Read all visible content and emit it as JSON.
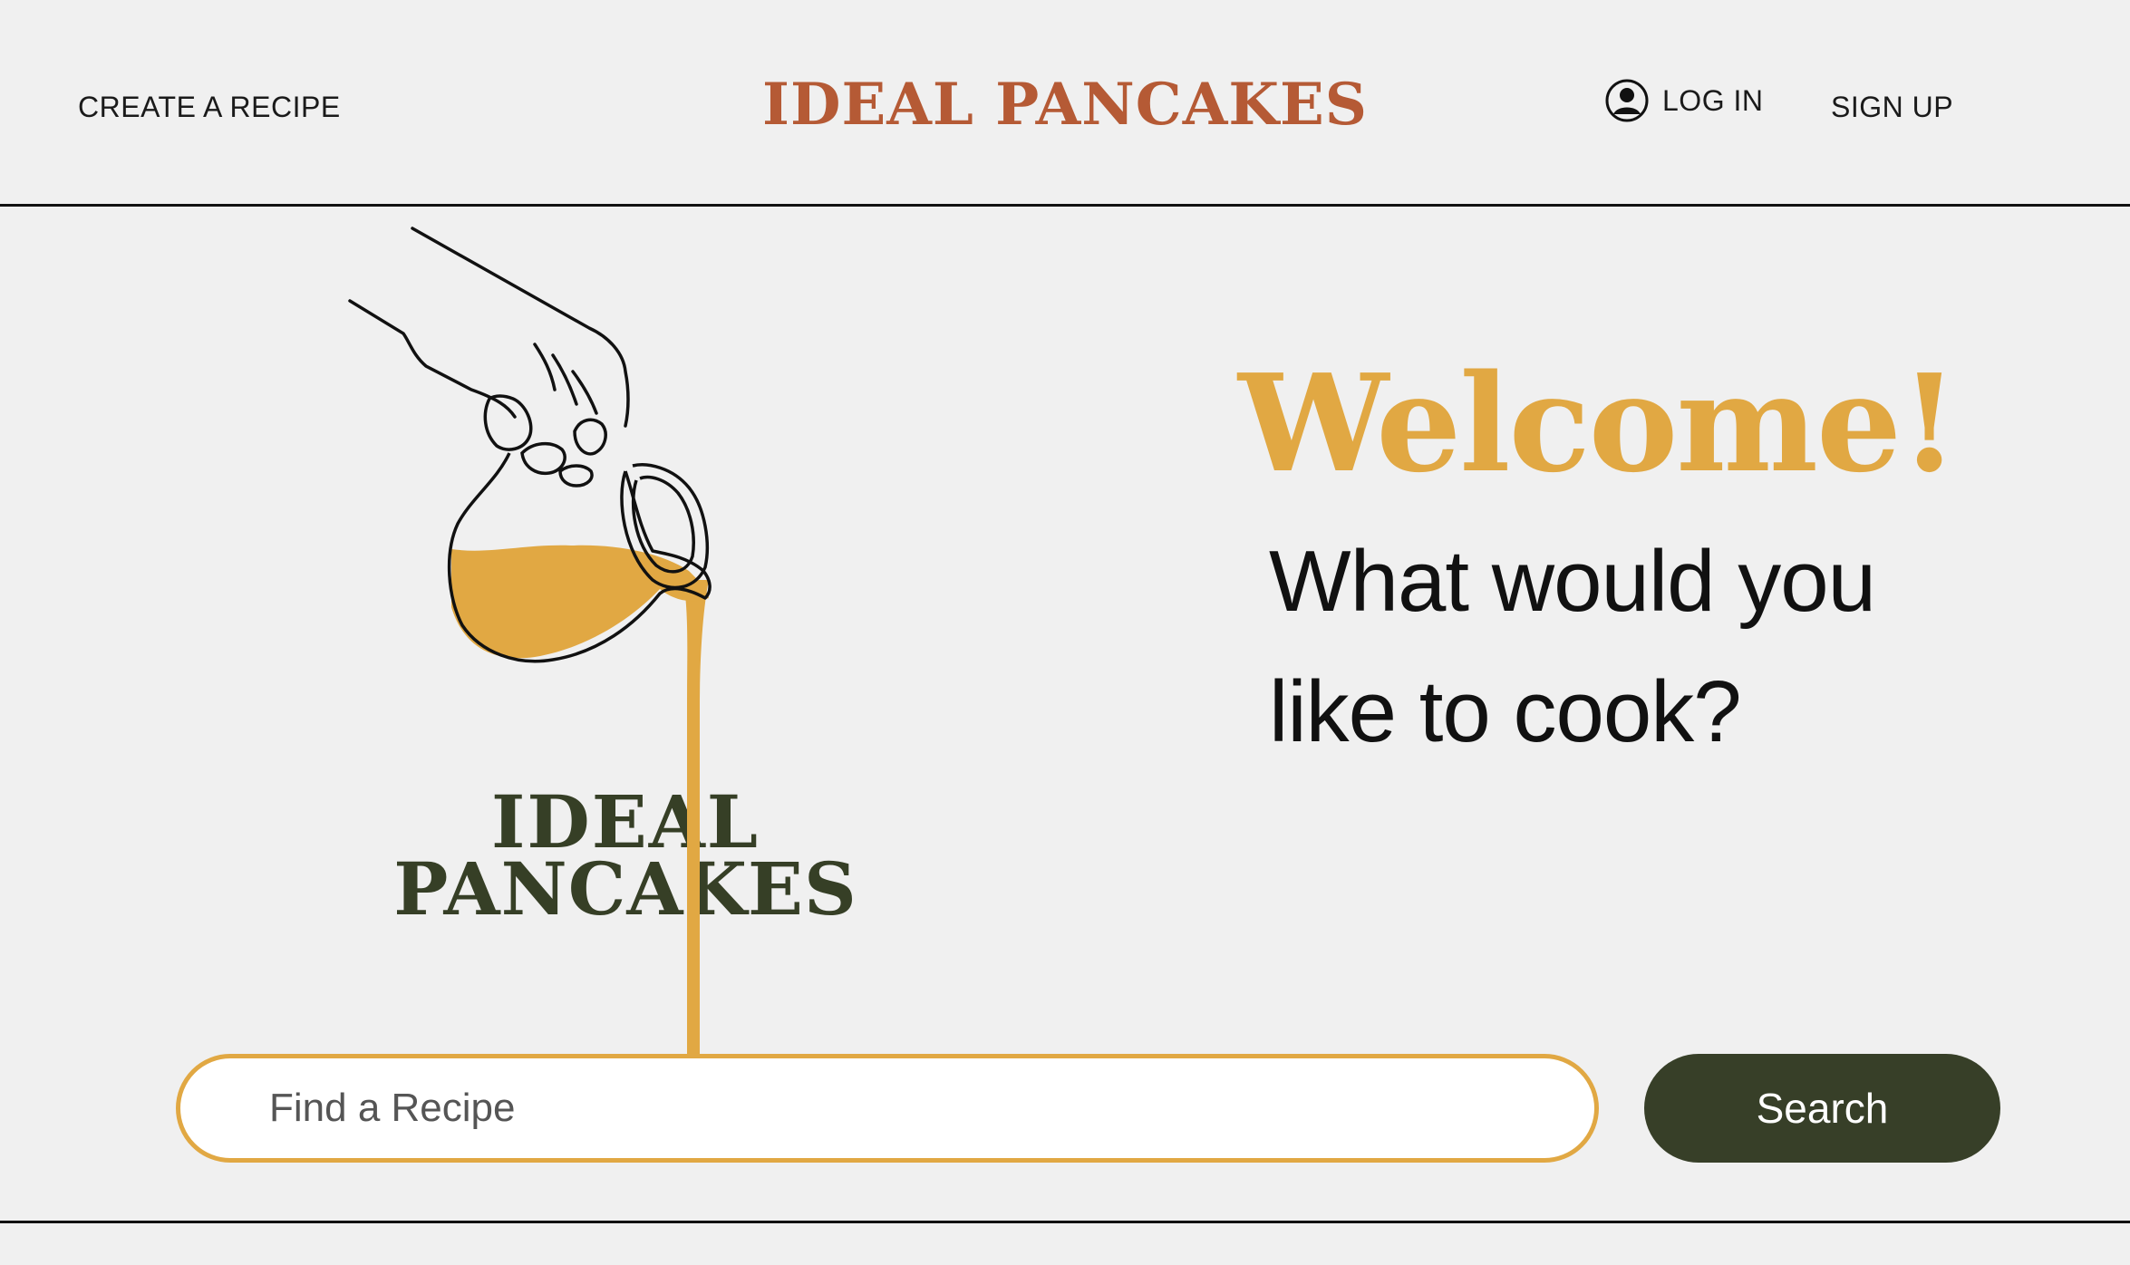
{
  "header": {
    "create_label": "CREATE A RECIPE",
    "brand_title": "IDEAL PANCAKES",
    "login_label": "LOG IN",
    "signup_label": "SIGN UP",
    "login_icon": "user-circle-icon"
  },
  "hero": {
    "logo_line1": "IDEAL",
    "logo_line2": "PANCAKES",
    "welcome": "Welcome!",
    "prompt": "What would you like to cook?"
  },
  "search": {
    "placeholder": "Find a Recipe",
    "value": "",
    "button_label": "Search"
  },
  "colors": {
    "background": "#f0f0f0",
    "brand_rust": "#b55a35",
    "accent_gold": "#e1a843",
    "dark_olive": "#373f28",
    "rule": "#111111"
  }
}
